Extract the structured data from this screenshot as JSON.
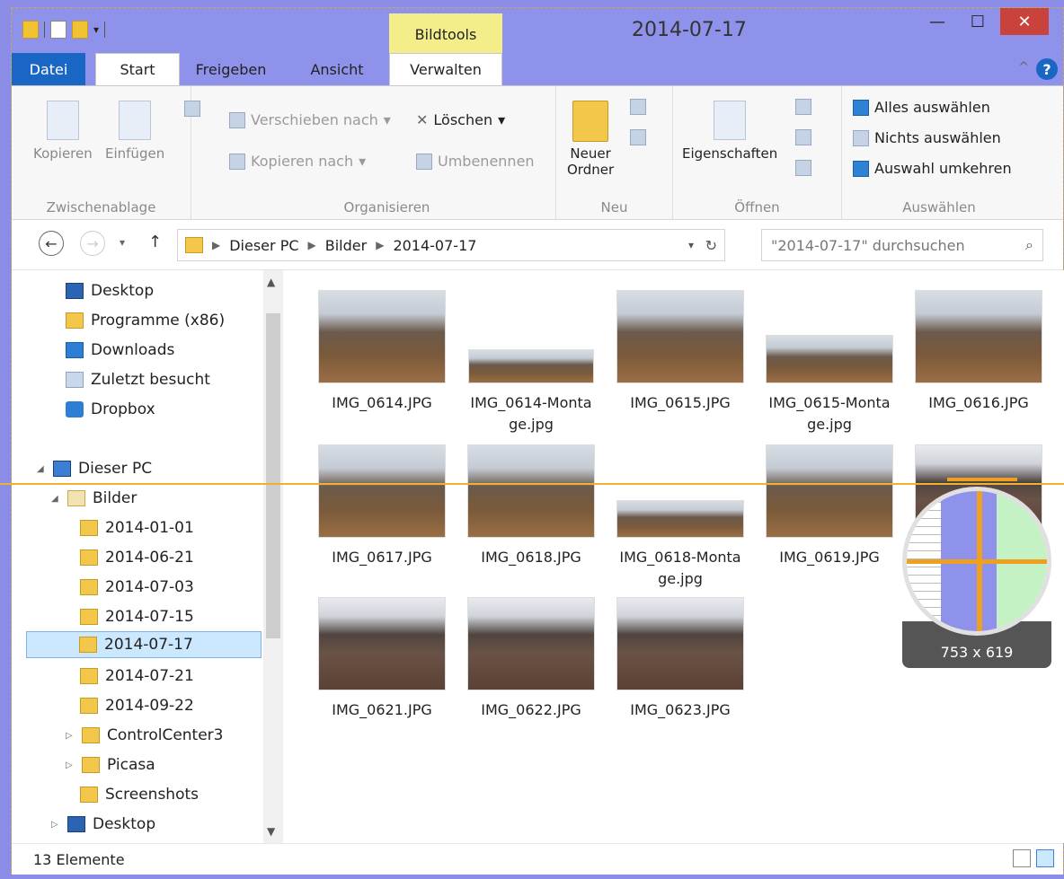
{
  "window": {
    "title": "2014-07-17",
    "context_tab": "Bildtools"
  },
  "tabs": {
    "file": "Datei",
    "start": "Start",
    "share": "Freigeben",
    "view": "Ansicht",
    "manage": "Verwalten"
  },
  "ribbon": {
    "clipboard": {
      "copy": "Kopieren",
      "paste": "Einfügen",
      "label": "Zwischenablage"
    },
    "organize": {
      "move": "Verschieben nach",
      "copyto": "Kopieren nach",
      "delete": "Löschen",
      "rename": "Umbenennen",
      "label": "Organisieren"
    },
    "new": {
      "folder_line1": "Neuer",
      "folder_line2": "Ordner",
      "label": "Neu"
    },
    "open": {
      "properties": "Eigenschaften",
      "label": "Öffnen"
    },
    "select": {
      "all": "Alles auswählen",
      "none": "Nichts auswählen",
      "invert": "Auswahl umkehren",
      "label": "Auswählen"
    }
  },
  "address": {
    "crumbs": [
      "Dieser PC",
      "Bilder",
      "2014-07-17"
    ],
    "search_placeholder": "\"2014-07-17\" durchsuchen"
  },
  "nav": {
    "favorites": [
      "Desktop",
      "Programme (x86)",
      "Downloads",
      "Zuletzt besucht",
      "Dropbox"
    ],
    "pc": "Dieser PC",
    "bilder": "Bilder",
    "folders": [
      "2014-01-01",
      "2014-06-21",
      "2014-07-03",
      "2014-07-15",
      "2014-07-17",
      "2014-07-21",
      "2014-09-22",
      "ControlCenter3",
      "Picasa",
      "Screenshots"
    ],
    "desktop2": "Desktop"
  },
  "files": [
    {
      "name": "IMG_0614.JPG"
    },
    {
      "name": "IMG_0614-Monta",
      "name2": "ge.jpg"
    },
    {
      "name": "IMG_0615.JPG"
    },
    {
      "name": "IMG_0615-Monta",
      "name2": "ge.jpg"
    },
    {
      "name": "IMG_0616.JPG"
    },
    {
      "name": "IMG_0617.JPG"
    },
    {
      "name": "IMG_0618.JPG"
    },
    {
      "name": "IMG_0618-Monta",
      "name2": "ge.jpg"
    },
    {
      "name": "IMG_0619.JPG"
    },
    {
      "name": "IMG_0621.JPG"
    },
    {
      "name": "IMG_0622.JPG"
    },
    {
      "name": "IMG_0623.JPG"
    }
  ],
  "status": {
    "count": "13 Elemente"
  },
  "magnifier": {
    "readout": "753 x 619"
  }
}
